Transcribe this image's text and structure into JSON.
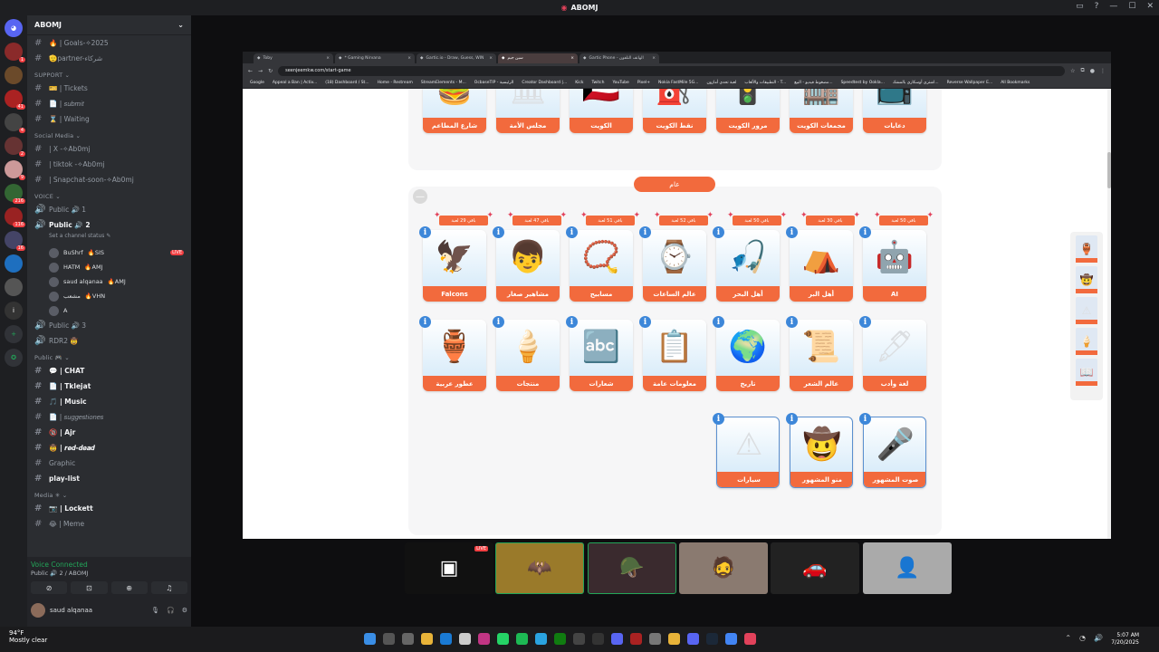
{
  "window": {
    "title": "ABOMJ"
  },
  "discord": {
    "server_name": "ABOMJ",
    "channels": [
      {
        "type": "text",
        "label": "🔥 | Goals-✧2025",
        "bold": false
      },
      {
        "type": "text",
        "label": "🫡partner-شركاء",
        "bold": false
      },
      {
        "type": "category",
        "label": "SUPPORT ⌄"
      },
      {
        "type": "text",
        "label": "🎫 | Tickets",
        "bold": false
      },
      {
        "type": "text",
        "label": "📄 | 𝑠𝑢𝑏𝑚𝑖𝑡",
        "bold": false
      },
      {
        "type": "text",
        "label": "⌛ | Waiting",
        "bold": false
      },
      {
        "type": "category",
        "label": "Social Media ⌄"
      },
      {
        "type": "text",
        "label": "| X -✧Ab0mj",
        "bold": false
      },
      {
        "type": "text",
        "label": "| tiktok -✧Ab0mj",
        "bold": false
      },
      {
        "type": "text",
        "label": "| Snapchat-soon-✧Ab0mj",
        "bold": false
      },
      {
        "type": "category",
        "label": "VOICE ⌄"
      },
      {
        "type": "voice",
        "label": "Public 🔊 1",
        "bold": false
      },
      {
        "type": "voice",
        "label": "Public 🔊 2",
        "bold": true,
        "status": "Set a channel status ✎"
      }
    ],
    "voice_users": [
      {
        "name": "BuShrf",
        "tag": "🔥SIS",
        "live": "LIVE"
      },
      {
        "name": "HATM",
        "tag": "🔥AMJ",
        "live": ""
      },
      {
        "name": "saud alqanaa",
        "tag": "🔥AMJ",
        "live": ""
      },
      {
        "name": "مشعب",
        "tag": "🔥VHN",
        "live": ""
      },
      {
        "name": "A",
        "tag": "",
        "live": ""
      }
    ],
    "channels2": [
      {
        "type": "voice",
        "label": "Public 🔊 3",
        "bold": false
      },
      {
        "type": "voice",
        "label": "RDR2 🤠",
        "bold": false
      },
      {
        "type": "category",
        "label": "Public 🎮 ⌄"
      },
      {
        "type": "text",
        "label": "💬 | CHAT",
        "bold": true
      },
      {
        "type": "text",
        "label": "📄 | Tklejat",
        "bold": true
      },
      {
        "type": "text",
        "label": "🎵 | Music",
        "bold": true
      },
      {
        "type": "text",
        "label": "📄 | 𝑠𝑢𝑔𝑔𝑒𝑠𝑡𝑖𝑜𝑛𝑒𝑠",
        "bold": false
      },
      {
        "type": "text",
        "label": "🔞 | Ajr",
        "bold": true
      },
      {
        "type": "text",
        "label": "🤠 | 𝒓𝒆𝒅-𝒅𝒆𝒂𝒅",
        "bold": true
      },
      {
        "type": "text",
        "label": "Graphic",
        "bold": false
      },
      {
        "type": "text",
        "label": "play-list",
        "bold": true
      },
      {
        "type": "category",
        "label": "Media ✳ ⌄"
      },
      {
        "type": "text",
        "label": "📷 | Lockett",
        "bold": true
      },
      {
        "type": "text",
        "label": "😂 | Meme",
        "bold": false
      }
    ],
    "voice_connected": "Voice Connected",
    "voice_channel": "Public 🔊 2 / ABOMJ",
    "user_name": "saud alqanaa"
  },
  "browser": {
    "tabs": [
      {
        "label": "Toby",
        "active": false
      },
      {
        "label": "* Gaming Nirvana",
        "active": false
      },
      {
        "label": "Gartic.io - Draw, Guess, WIN",
        "active": false
      },
      {
        "label": "سين جيم",
        "active": true
      },
      {
        "label": "Gartic Phone - الهاتف التلفون",
        "active": false
      }
    ],
    "url": "seenjeemkw.com/start-game",
    "bookmarks": [
      "Google",
      "Appeal a Ban | Activ...",
      "(18) Dashboard / St...",
      "Home - Restream",
      "StreamElements - M...",
      "OcbaseTIP - الرئيسية",
      "Creator Dashboard |...",
      "Kick",
      "Twitch",
      "YouTube",
      "Pixel+",
      "Nokia FastMile 5G...",
      "لعبة تحدي أمازون",
      "التطبيقات والألعاب - T...",
      "مضغوط فيديو - البيع...",
      "Speedtest by Ookla...",
      "اشتري أوسكاري بالمشك...",
      "Reverse Wallpaper E...",
      "All Bookmarks"
    ]
  },
  "game": {
    "top_row": [
      "شارع المطاعم",
      "مجلس الأمة",
      "الكويت",
      "نقط الكويت",
      "مرور الكويت",
      "مجمعات الكويت",
      "دعايات"
    ],
    "section_label": "عام",
    "row1": [
      {
        "label": "Falcons",
        "ribbon": "باقي 29 لعبة"
      },
      {
        "label": "مشاهير صغار",
        "ribbon": "باقي 47 لعبة"
      },
      {
        "label": "مسابيح",
        "ribbon": "باقي 51 لعبة"
      },
      {
        "label": "عالم الساعات",
        "ribbon": "باقي 52 لعبة"
      },
      {
        "label": "أهل البحر",
        "ribbon": "باقي 50 لعبة"
      },
      {
        "label": "أهل البر",
        "ribbon": "باقي 30 لعبة"
      },
      {
        "label": "AI",
        "ribbon": "باقي 50 لعبة"
      }
    ],
    "row2": [
      "عطور عربية",
      "منتجات",
      "شعارات",
      "معلومات عامة",
      "تاريخ",
      "عالم الشعر",
      "لغة وأدب"
    ],
    "row3": [
      "سيارات",
      "منو المشهور",
      "صوت المشهور"
    ]
  },
  "taskbar": {
    "weather": "94°F",
    "weather_sub": "Mostly clear",
    "time": "5:07 AM",
    "date": "7/20/2025"
  }
}
